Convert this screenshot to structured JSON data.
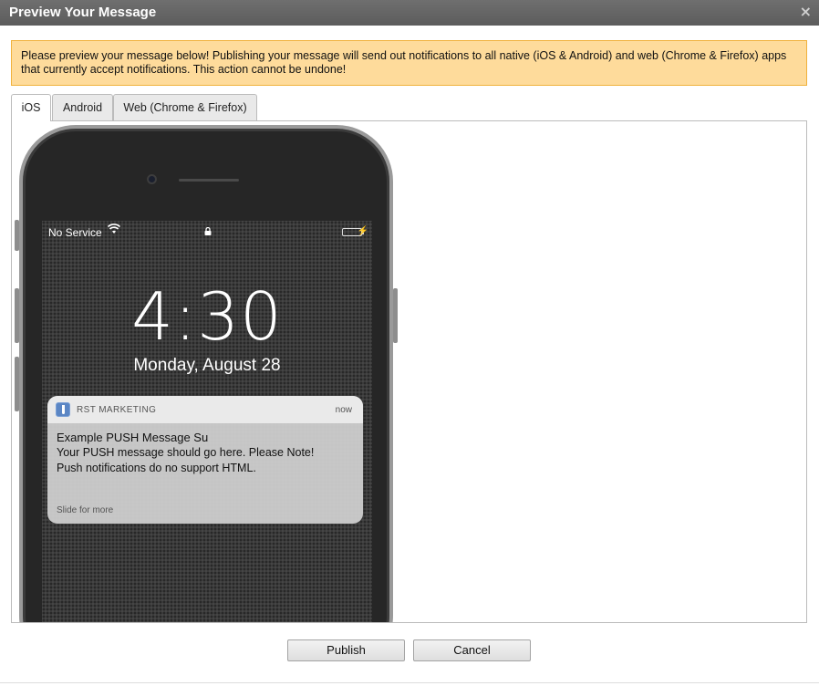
{
  "dialog": {
    "title": "Preview Your Message",
    "close_glyph": "×"
  },
  "warning": {
    "text": "Please preview your message below! Publishing your message will send out notifications to all native (iOS & Android) and web (Chrome & Firefox) apps that currently accept notifications. This action cannot be undone!"
  },
  "tabs": [
    {
      "label": "iOS",
      "active": true
    },
    {
      "label": "Android",
      "active": false
    },
    {
      "label": "Web (Chrome & Firefox)",
      "active": false
    }
  ],
  "phone": {
    "carrier": "No Service",
    "time": "4:30",
    "date": "Monday, August 28",
    "battery_color": "#4cd964",
    "notification": {
      "app_name": "RST MARKETING",
      "timestamp": "now",
      "title": "Example PUSH Message Su",
      "body_line1": "Your PUSH message should go here. Please Note!",
      "body_line2": "Push notifications do no support HTML.",
      "more": "Slide for more"
    }
  },
  "buttons": {
    "publish": "Publish",
    "cancel": "Cancel"
  },
  "colors": {
    "titlebar": "#666666",
    "warning_bg": "#fedb9b",
    "warning_border": "#f0b13c"
  }
}
